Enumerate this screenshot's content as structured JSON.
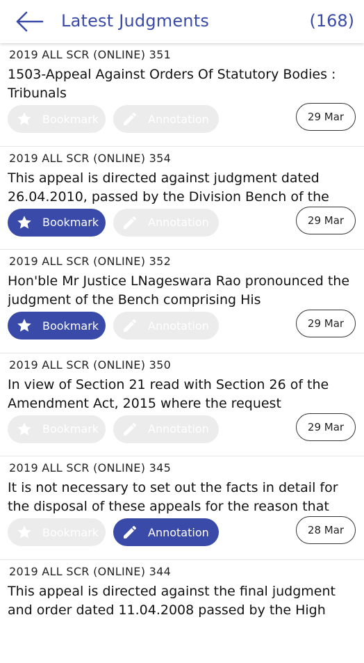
{
  "header": {
    "title": "Latest Judgments",
    "count": "(168)",
    "back_icon": "arrow-left-icon",
    "accent": "#3a4aa8"
  },
  "items": [
    {
      "citation": "2019 ALL SCR (ONLINE) 351",
      "snippet": "1503-Appeal Against Orders Of Statutory Bodies : Tribunals",
      "bookmark_label": "Bookmark",
      "annotation_label": "Annotation",
      "bookmarked": false,
      "annotated": false,
      "date": "29 Mar"
    },
    {
      "citation": "2019 ALL SCR (ONLINE) 354",
      "snippet": "This appeal is directed against judgment dated 26.04.2010, passed by the Division Bench of the",
      "bookmark_label": "Bookmark",
      "annotation_label": "Annotation",
      "bookmarked": true,
      "annotated": false,
      "date": "29 Mar"
    },
    {
      "citation": "2019 ALL SCR (ONLINE) 352",
      "snippet": "Hon'ble Mr Justice LNageswara Rao pronounced the judgment of the Bench comprising His",
      "bookmark_label": "Bookmark",
      "annotation_label": "Annotation",
      "bookmarked": true,
      "annotated": false,
      "date": "29 Mar"
    },
    {
      "citation": "2019 ALL SCR (ONLINE) 350",
      "snippet": "In view of Section 21 read with Section 26 of the Amendment Act, 2015 where the request",
      "bookmark_label": "Bookmark",
      "annotation_label": "Annotation",
      "bookmarked": false,
      "annotated": false,
      "date": "29 Mar"
    },
    {
      "citation": "2019 ALL SCR (ONLINE) 345",
      "snippet": "It is not necessary to set out the facts in detail for the disposal of these appeals for the reason that",
      "bookmark_label": "Bookmark",
      "annotation_label": "Annotation",
      "bookmarked": false,
      "annotated": true,
      "date": "28 Mar"
    },
    {
      "citation": "2019 ALL SCR (ONLINE) 344",
      "snippet": "This appeal is directed against the final judgment and order dated 11.04.2008 passed by the High",
      "bookmark_label": "Bookmark",
      "annotation_label": "Annotation",
      "bookmarked": false,
      "annotated": false,
      "date": ""
    }
  ]
}
